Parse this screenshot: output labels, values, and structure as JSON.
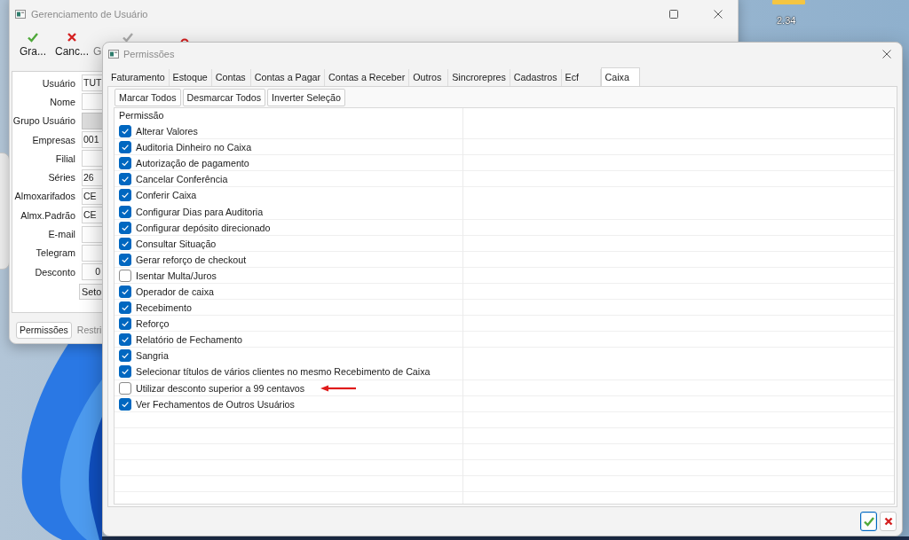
{
  "desktop": {
    "icon_label": "2.34"
  },
  "back_window": {
    "title": "Gerenciamento de Usuário",
    "toolbar": [
      {
        "kind": "check",
        "label": "Gra...",
        "disabled": false
      },
      {
        "kind": "cross",
        "label": "Canc...",
        "disabled": false
      },
      {
        "kind": "none",
        "label": "G",
        "disabled": true
      },
      {
        "kind": "check",
        "disabled": true
      },
      {
        "kind": "circle",
        "disabled": false
      }
    ],
    "fields": [
      {
        "label": "Usuário",
        "value": "TUT",
        "kind": "text",
        "disabled": false
      },
      {
        "label": "Nome",
        "kind": "text",
        "disabled": false
      },
      {
        "label": "Grupo Usuário",
        "kind": "text",
        "disabled": true
      },
      {
        "label": "Empresas",
        "value": "001",
        "kind": "text",
        "disabled": false
      },
      {
        "label": "Filial",
        "kind": "text",
        "disabled": false
      },
      {
        "label": "Séries",
        "value": "26",
        "kind": "text",
        "disabled": false
      },
      {
        "label": "Almoxarifados",
        "value": "CE",
        "kind": "text",
        "disabled": false
      },
      {
        "label": "Almx.Padrão",
        "value": "CE",
        "kind": "text",
        "disabled": false
      },
      {
        "label": "E-mail",
        "kind": "text",
        "disabled": false
      },
      {
        "label": "Telegram",
        "kind": "text",
        "disabled": false
      },
      {
        "label": "Desconto",
        "value": "0",
        "kind": "number",
        "disabled": false
      }
    ],
    "form_button": "Seto",
    "bottom_buttons": [
      {
        "label": "Permissões",
        "disabled": false
      },
      {
        "label": "Restri",
        "disabled": true
      }
    ]
  },
  "window": {
    "title": "Permissões",
    "tabs": [
      {
        "label": "Faturamento",
        "selected": false
      },
      {
        "label": "Estoque",
        "selected": false
      },
      {
        "label": "Contas",
        "selected": false
      },
      {
        "label": "Contas a Pagar",
        "selected": false
      },
      {
        "label": "Contas a Receber",
        "selected": false
      },
      {
        "label": "Outros",
        "selected": false
      },
      {
        "label": "Sincrorepres",
        "selected": false
      },
      {
        "label": "Cadastros",
        "selected": false
      },
      {
        "label": "Ecf",
        "selected": false
      },
      {
        "label": "Caixa",
        "selected": true
      }
    ],
    "buttons": [
      "Marcar Todos",
      "Desmarcar Todos",
      "Inverter Seleção"
    ],
    "table": {
      "columns": [
        "Permissão"
      ],
      "rows": [
        {
          "label": "Alterar Valores",
          "checked": true,
          "highlighted": false
        },
        {
          "label": "Auditoria Dinheiro no Caixa",
          "checked": true,
          "highlighted": false
        },
        {
          "label": "Autorização de pagamento",
          "checked": true,
          "highlighted": false
        },
        {
          "label": "Cancelar Conferência",
          "checked": true,
          "highlighted": false
        },
        {
          "label": "Conferir Caixa",
          "checked": true,
          "highlighted": false
        },
        {
          "label": "Configurar Dias para Auditoria",
          "checked": true,
          "highlighted": false
        },
        {
          "label": "Configurar depósito direcionado",
          "checked": true,
          "highlighted": false
        },
        {
          "label": "Consultar Situação",
          "checked": true,
          "highlighted": false
        },
        {
          "label": "Gerar reforço de checkout",
          "checked": true,
          "highlighted": false
        },
        {
          "label": "Isentar Multa/Juros",
          "checked": false,
          "highlighted": false
        },
        {
          "label": "Operador de caixa",
          "checked": true,
          "highlighted": false
        },
        {
          "label": "Recebimento",
          "checked": true,
          "highlighted": false
        },
        {
          "label": "Reforço",
          "checked": true,
          "highlighted": false
        },
        {
          "label": "Relatório de Fechamento",
          "checked": true,
          "highlighted": false
        },
        {
          "label": "Sangria",
          "checked": true,
          "highlighted": false
        },
        {
          "label": "Selecionar títulos de vários clientes no mesmo Recebimento de Caixa",
          "checked": true,
          "highlighted": false
        },
        {
          "label": "Utilizar desconto superior a 99 centavos",
          "checked": false,
          "highlighted": true
        },
        {
          "label": "Ver Fechamentos de Outros Usuários",
          "checked": true,
          "highlighted": false
        }
      ]
    },
    "dialog_buttons": [
      {
        "kind": "ok",
        "focused": true
      },
      {
        "kind": "cancel",
        "focused": false
      }
    ]
  }
}
